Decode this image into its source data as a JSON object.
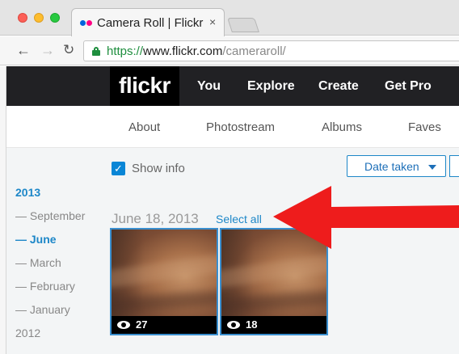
{
  "browser": {
    "tab_title": "Camera Roll | Flickr",
    "tab_close": "×",
    "url_scheme": "https://",
    "url_host": "www.flickr.com",
    "url_path": "/cameraroll/"
  },
  "flickr_nav": {
    "logo": "flickr",
    "items": [
      "You",
      "Explore",
      "Create",
      "Get Pro"
    ]
  },
  "sub_nav": {
    "items": [
      "About",
      "Photostream",
      "Albums",
      "Faves"
    ]
  },
  "toolbar": {
    "show_info_label": "Show info",
    "show_info_checked": true,
    "sort_label": "Date taken"
  },
  "timeline": {
    "year_2013": "2013",
    "months": [
      "— September",
      "— June",
      "— March",
      "— February",
      "— January"
    ],
    "active_month": "— June",
    "year_2012": "2012"
  },
  "group": {
    "date": "June 18, 2013",
    "select_all": "Select all"
  },
  "photos": [
    {
      "views": "27"
    },
    {
      "views": "18"
    }
  ],
  "colors": {
    "accent": "#1d87c8",
    "annotation_arrow": "#ee1c1c",
    "nav_bg": "#212124"
  }
}
